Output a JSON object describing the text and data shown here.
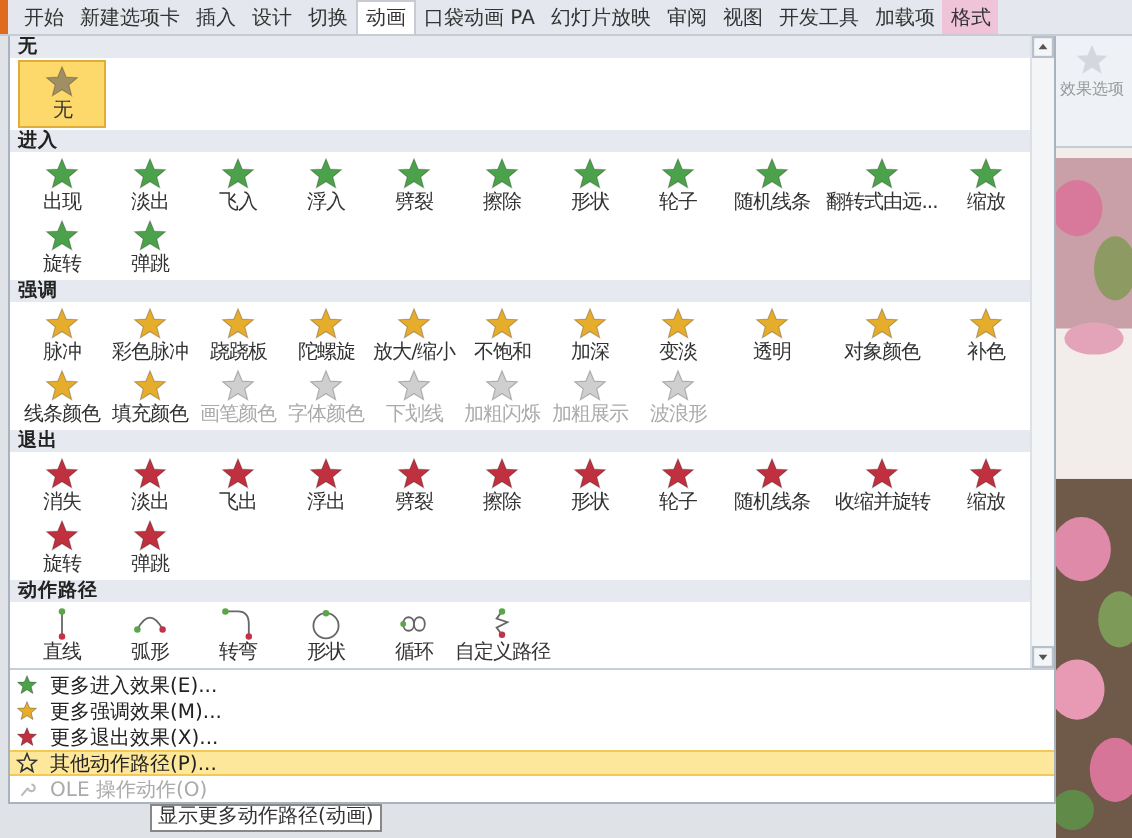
{
  "tabs": [
    {
      "label": "开始",
      "selected": false,
      "contextual": false
    },
    {
      "label": "新建选项卡",
      "selected": false,
      "contextual": false
    },
    {
      "label": "插入",
      "selected": false,
      "contextual": false
    },
    {
      "label": "设计",
      "selected": false,
      "contextual": false
    },
    {
      "label": "切换",
      "selected": false,
      "contextual": false
    },
    {
      "label": "动画",
      "selected": true,
      "contextual": false
    },
    {
      "label": "口袋动画 PA",
      "selected": false,
      "contextual": false
    },
    {
      "label": "幻灯片放映",
      "selected": false,
      "contextual": false
    },
    {
      "label": "审阅",
      "selected": false,
      "contextual": false
    },
    {
      "label": "视图",
      "selected": false,
      "contextual": false
    },
    {
      "label": "开发工具",
      "selected": false,
      "contextual": false
    },
    {
      "label": "加载项",
      "selected": false,
      "contextual": false
    },
    {
      "label": "格式",
      "selected": false,
      "contextual": true
    }
  ],
  "gallery": {
    "sections": [
      {
        "title": "无",
        "kind": "none",
        "items": [
          {
            "label": "无",
            "selected": true,
            "disabled": false
          }
        ]
      },
      {
        "title": "进入",
        "kind": "entrance",
        "items": [
          {
            "label": "出现",
            "selected": false,
            "disabled": false
          },
          {
            "label": "淡出",
            "selected": false,
            "disabled": false
          },
          {
            "label": "飞入",
            "selected": false,
            "disabled": false
          },
          {
            "label": "浮入",
            "selected": false,
            "disabled": false
          },
          {
            "label": "劈裂",
            "selected": false,
            "disabled": false
          },
          {
            "label": "擦除",
            "selected": false,
            "disabled": false
          },
          {
            "label": "形状",
            "selected": false,
            "disabled": false
          },
          {
            "label": "轮子",
            "selected": false,
            "disabled": false
          },
          {
            "label": "随机线条",
            "selected": false,
            "disabled": false
          },
          {
            "label": "翻转式由远...",
            "selected": false,
            "disabled": false
          },
          {
            "label": "缩放",
            "selected": false,
            "disabled": false
          },
          {
            "label": "旋转",
            "selected": false,
            "disabled": false
          },
          {
            "label": "弹跳",
            "selected": false,
            "disabled": false
          }
        ]
      },
      {
        "title": "强调",
        "kind": "emphasis",
        "items": [
          {
            "label": "脉冲",
            "selected": false,
            "disabled": false
          },
          {
            "label": "彩色脉冲",
            "selected": false,
            "disabled": false
          },
          {
            "label": "跷跷板",
            "selected": false,
            "disabled": false
          },
          {
            "label": "陀螺旋",
            "selected": false,
            "disabled": false
          },
          {
            "label": "放大/缩小",
            "selected": false,
            "disabled": false
          },
          {
            "label": "不饱和",
            "selected": false,
            "disabled": false
          },
          {
            "label": "加深",
            "selected": false,
            "disabled": false
          },
          {
            "label": "变淡",
            "selected": false,
            "disabled": false
          },
          {
            "label": "透明",
            "selected": false,
            "disabled": false
          },
          {
            "label": "对象颜色",
            "selected": false,
            "disabled": false
          },
          {
            "label": "补色",
            "selected": false,
            "disabled": false
          },
          {
            "label": "线条颜色",
            "selected": false,
            "disabled": false
          },
          {
            "label": "填充颜色",
            "selected": false,
            "disabled": false
          },
          {
            "label": "画笔颜色",
            "selected": false,
            "disabled": true
          },
          {
            "label": "字体颜色",
            "selected": false,
            "disabled": true
          },
          {
            "label": "下划线",
            "selected": false,
            "disabled": true
          },
          {
            "label": "加粗闪烁",
            "selected": false,
            "disabled": true
          },
          {
            "label": "加粗展示",
            "selected": false,
            "disabled": true
          },
          {
            "label": "波浪形",
            "selected": false,
            "disabled": true
          }
        ]
      },
      {
        "title": "退出",
        "kind": "exit",
        "items": [
          {
            "label": "消失",
            "selected": false,
            "disabled": false
          },
          {
            "label": "淡出",
            "selected": false,
            "disabled": false
          },
          {
            "label": "飞出",
            "selected": false,
            "disabled": false
          },
          {
            "label": "浮出",
            "selected": false,
            "disabled": false
          },
          {
            "label": "劈裂",
            "selected": false,
            "disabled": false
          },
          {
            "label": "擦除",
            "selected": false,
            "disabled": false
          },
          {
            "label": "形状",
            "selected": false,
            "disabled": false
          },
          {
            "label": "轮子",
            "selected": false,
            "disabled": false
          },
          {
            "label": "随机线条",
            "selected": false,
            "disabled": false
          },
          {
            "label": "收缩并旋转",
            "selected": false,
            "disabled": false
          },
          {
            "label": "缩放",
            "selected": false,
            "disabled": false
          },
          {
            "label": "旋转",
            "selected": false,
            "disabled": false
          },
          {
            "label": "弹跳",
            "selected": false,
            "disabled": false
          }
        ]
      },
      {
        "title": "动作路径",
        "kind": "path",
        "items": [
          {
            "label": "直线",
            "selected": false,
            "disabled": false
          },
          {
            "label": "弧形",
            "selected": false,
            "disabled": false
          },
          {
            "label": "转弯",
            "selected": false,
            "disabled": false
          },
          {
            "label": "形状",
            "selected": false,
            "disabled": false
          },
          {
            "label": "循环",
            "selected": false,
            "disabled": false
          },
          {
            "label": "自定义路径",
            "selected": false,
            "disabled": false
          }
        ]
      }
    ]
  },
  "menu": [
    {
      "label": "更多进入效果(E)...",
      "kind": "entrance",
      "highlighted": false,
      "disabled": false
    },
    {
      "label": "更多强调效果(M)...",
      "kind": "emphasis",
      "highlighted": false,
      "disabled": false
    },
    {
      "label": "更多退出效果(X)...",
      "kind": "exit",
      "highlighted": false,
      "disabled": false
    },
    {
      "label": "其他动作路径(P)...",
      "kind": "path",
      "highlighted": true,
      "disabled": false
    },
    {
      "label": "OLE 操作动作(O)",
      "kind": "ole",
      "highlighted": false,
      "disabled": true
    }
  ],
  "tooltip": "显示更多动作路径(动画)",
  "ribbon": {
    "effect_options": "效果选项"
  }
}
